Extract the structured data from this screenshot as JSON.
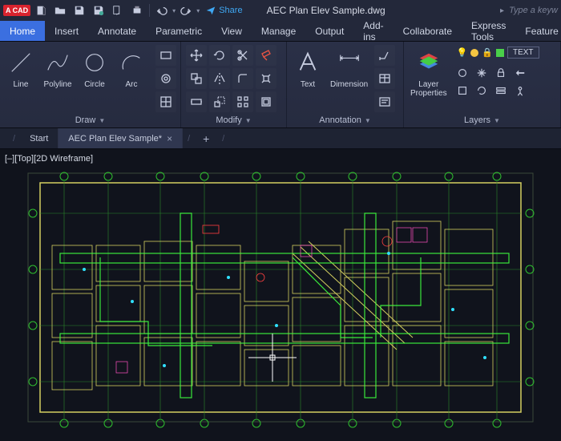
{
  "app": {
    "logo": "A CAD"
  },
  "title": {
    "docname": "AEC Plan Elev Sample.dwg",
    "share": "Share",
    "search_placeholder": "Type a keyw"
  },
  "menu": {
    "tabs": [
      "Home",
      "Insert",
      "Annotate",
      "Parametric",
      "View",
      "Manage",
      "Output",
      "Add-ins",
      "Collaborate",
      "Express Tools",
      "Feature"
    ],
    "active": 0
  },
  "ribbon": {
    "draw": {
      "title": "Draw",
      "big": [
        {
          "label": "Line",
          "icon": "line"
        },
        {
          "label": "Polyline",
          "icon": "polyline"
        },
        {
          "label": "Circle",
          "icon": "circle"
        },
        {
          "label": "Arc",
          "icon": "arc"
        }
      ]
    },
    "modify": {
      "title": "Modify"
    },
    "annotation": {
      "title": "Annotation",
      "big": [
        {
          "label": "Text",
          "icon": "text"
        },
        {
          "label": "Dimension",
          "icon": "dimension"
        }
      ]
    },
    "layers": {
      "title": "Layers",
      "big_label": "Layer\nProperties",
      "text_label": "TEXT"
    }
  },
  "filetabs": {
    "tabs": [
      {
        "label": "Start",
        "active": false,
        "closable": false
      },
      {
        "label": "AEC Plan Elev Sample*",
        "active": true,
        "closable": true
      }
    ]
  },
  "viewport": {
    "label": "[–][Top][2D Wireframe]"
  }
}
